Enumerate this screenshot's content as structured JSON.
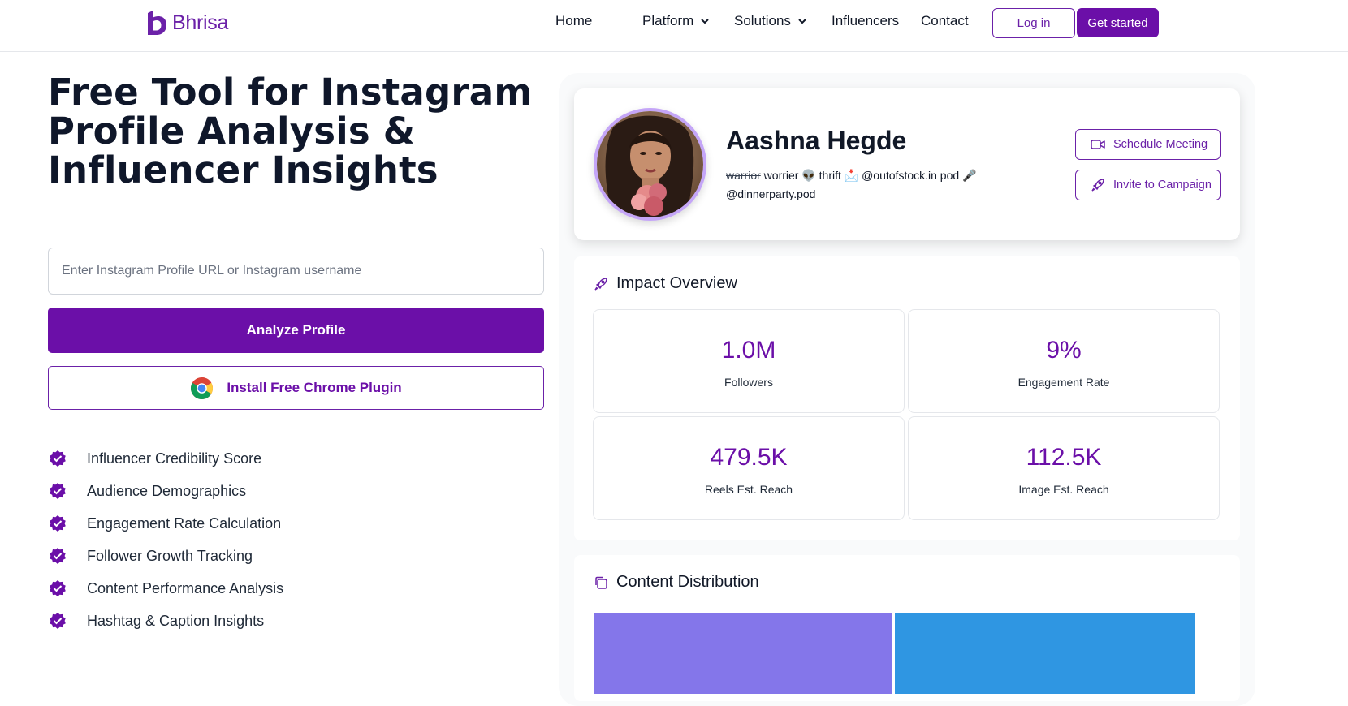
{
  "header": {
    "logo_text": "Bhrisa",
    "nav": [
      {
        "label": "Home"
      },
      {
        "label": "Platform"
      },
      {
        "label": "Solutions"
      },
      {
        "label": "Influencers"
      },
      {
        "label": "Contact"
      }
    ],
    "login_label": "Log in",
    "get_started_label": "Get started"
  },
  "hero": {
    "title": "Free Tool for Instagram Profile Analysis & Influencer Insights",
    "input_placeholder": "Enter Instagram Profile URL or Instagram username",
    "input_value": "",
    "analyze_label": "Analyze Profile",
    "plugin_label": "Install Free Chrome Plugin",
    "features": [
      "Influencer Credibility Score",
      "Audience Demographics",
      "Engagement Rate Calculation",
      "Follower Growth Tracking",
      "Content Performance Analysis",
      "Hashtag & Caption Insights"
    ]
  },
  "profile": {
    "name": "Aashna Hegde",
    "bio_strike": "warrior",
    "bio_line1": " worrier 👽 thrift 📩 @outofstock.in pod 🎤",
    "bio_line2": "@dinnerparty.pod",
    "schedule_label": "Schedule Meeting",
    "invite_label": "Invite to Campaign"
  },
  "impact": {
    "title": "Impact Overview",
    "stats": [
      {
        "value": "1.0M",
        "label": "Followers"
      },
      {
        "value": "9%",
        "label": "Engagement Rate"
      },
      {
        "value": "479.5K",
        "label": "Reels Est. Reach"
      },
      {
        "value": "112.5K",
        "label": "Image Est. Reach"
      }
    ]
  },
  "content": {
    "title": "Content Distribution",
    "colors": [
      "#8476ea",
      "#2f96e2"
    ]
  },
  "colors": {
    "brand": "#6b0fa8",
    "panel_bg": "#f9fafb"
  }
}
